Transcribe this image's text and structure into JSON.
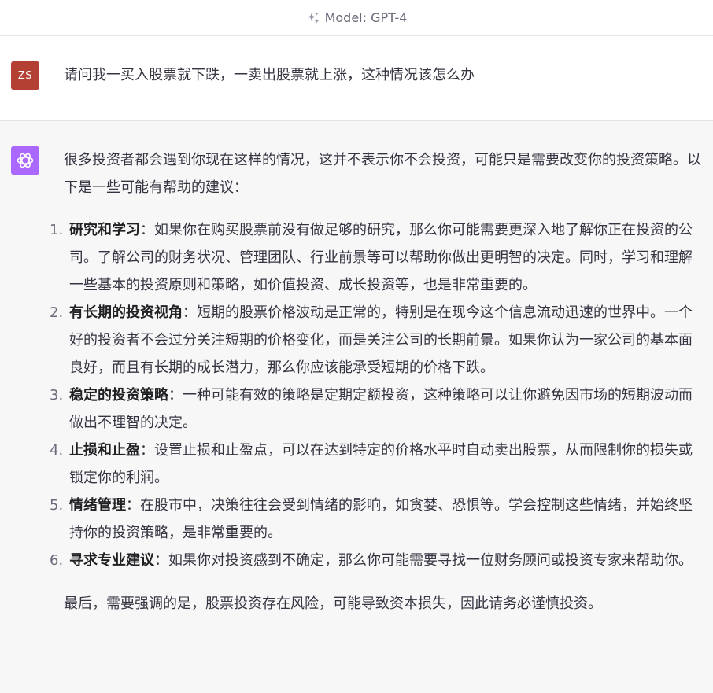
{
  "header": {
    "model_label": "Model: GPT-4",
    "sparkle_icon": "sparkle-icon"
  },
  "user_message": {
    "avatar_initials": "ZS",
    "avatar_color": "#b44033",
    "text": "请问我一买入股票就下跌，一卖出股票就上涨，这种情况该怎么办"
  },
  "assistant_message": {
    "avatar_icon": "openai-logo-icon",
    "avatar_color": "#ab68ff",
    "intro": "很多投资者都会遇到你现在这样的情况，这并不表示你不会投资，可能只是需要改变你的投资策略。以下是一些可能有帮助的建议：",
    "items": [
      {
        "number": "1.",
        "title": "研究和学习",
        "text": "：如果你在购买股票前没有做足够的研究，那么你可能需要更深入地了解你正在投资的公司。了解公司的财务状况、管理团队、行业前景等可以帮助你做出更明智的决定。同时，学习和理解一些基本的投资原则和策略，如价值投资、成长投资等，也是非常重要的。"
      },
      {
        "number": "2.",
        "title": "有长期的投资视角",
        "text": "：短期的股票价格波动是正常的，特别是在现今这个信息流动迅速的世界中。一个好的投资者不会过分关注短期的价格变化，而是关注公司的长期前景。如果你认为一家公司的基本面良好，而且有长期的成长潜力，那么你应该能承受短期的价格下跌。"
      },
      {
        "number": "3.",
        "title": "稳定的投资策略",
        "text": "：一种可能有效的策略是定期定额投资，这种策略可以让你避免因市场的短期波动而做出不理智的决定。"
      },
      {
        "number": "4.",
        "title": "止损和止盈",
        "text": "：设置止损和止盈点，可以在达到特定的价格水平时自动卖出股票，从而限制你的损失或锁定你的利润。"
      },
      {
        "number": "5.",
        "title": "情绪管理",
        "text": "：在股市中，决策往往会受到情绪的影响，如贪婪、恐惧等。学会控制这些情绪，并始终坚持你的投资策略，是非常重要的。"
      },
      {
        "number": "6.",
        "title": "寻求专业建议",
        "text": "：如果你对投资感到不确定，那么你可能需要寻找一位财务顾问或投资专家来帮助你。"
      }
    ],
    "closing": "最后，需要强调的是，股票投资存在风险，可能导致资本损失，因此请务必谨慎投资。"
  }
}
